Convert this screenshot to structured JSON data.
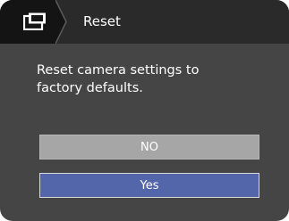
{
  "header": {
    "icon": "camera-settings-icon",
    "title": "Reset"
  },
  "dialog": {
    "message_line1": "Reset camera settings to",
    "message_line2": "factory defaults."
  },
  "options": {
    "no_label": "NO",
    "yes_label": "Yes",
    "selected": "Yes"
  },
  "colors": {
    "screen_bg": "#454545",
    "header_bg": "#2a2a2a",
    "icon_cell_bg": "#141414",
    "no_bg": "#a6a6a6",
    "yes_selected_bg": "#5266a9"
  }
}
